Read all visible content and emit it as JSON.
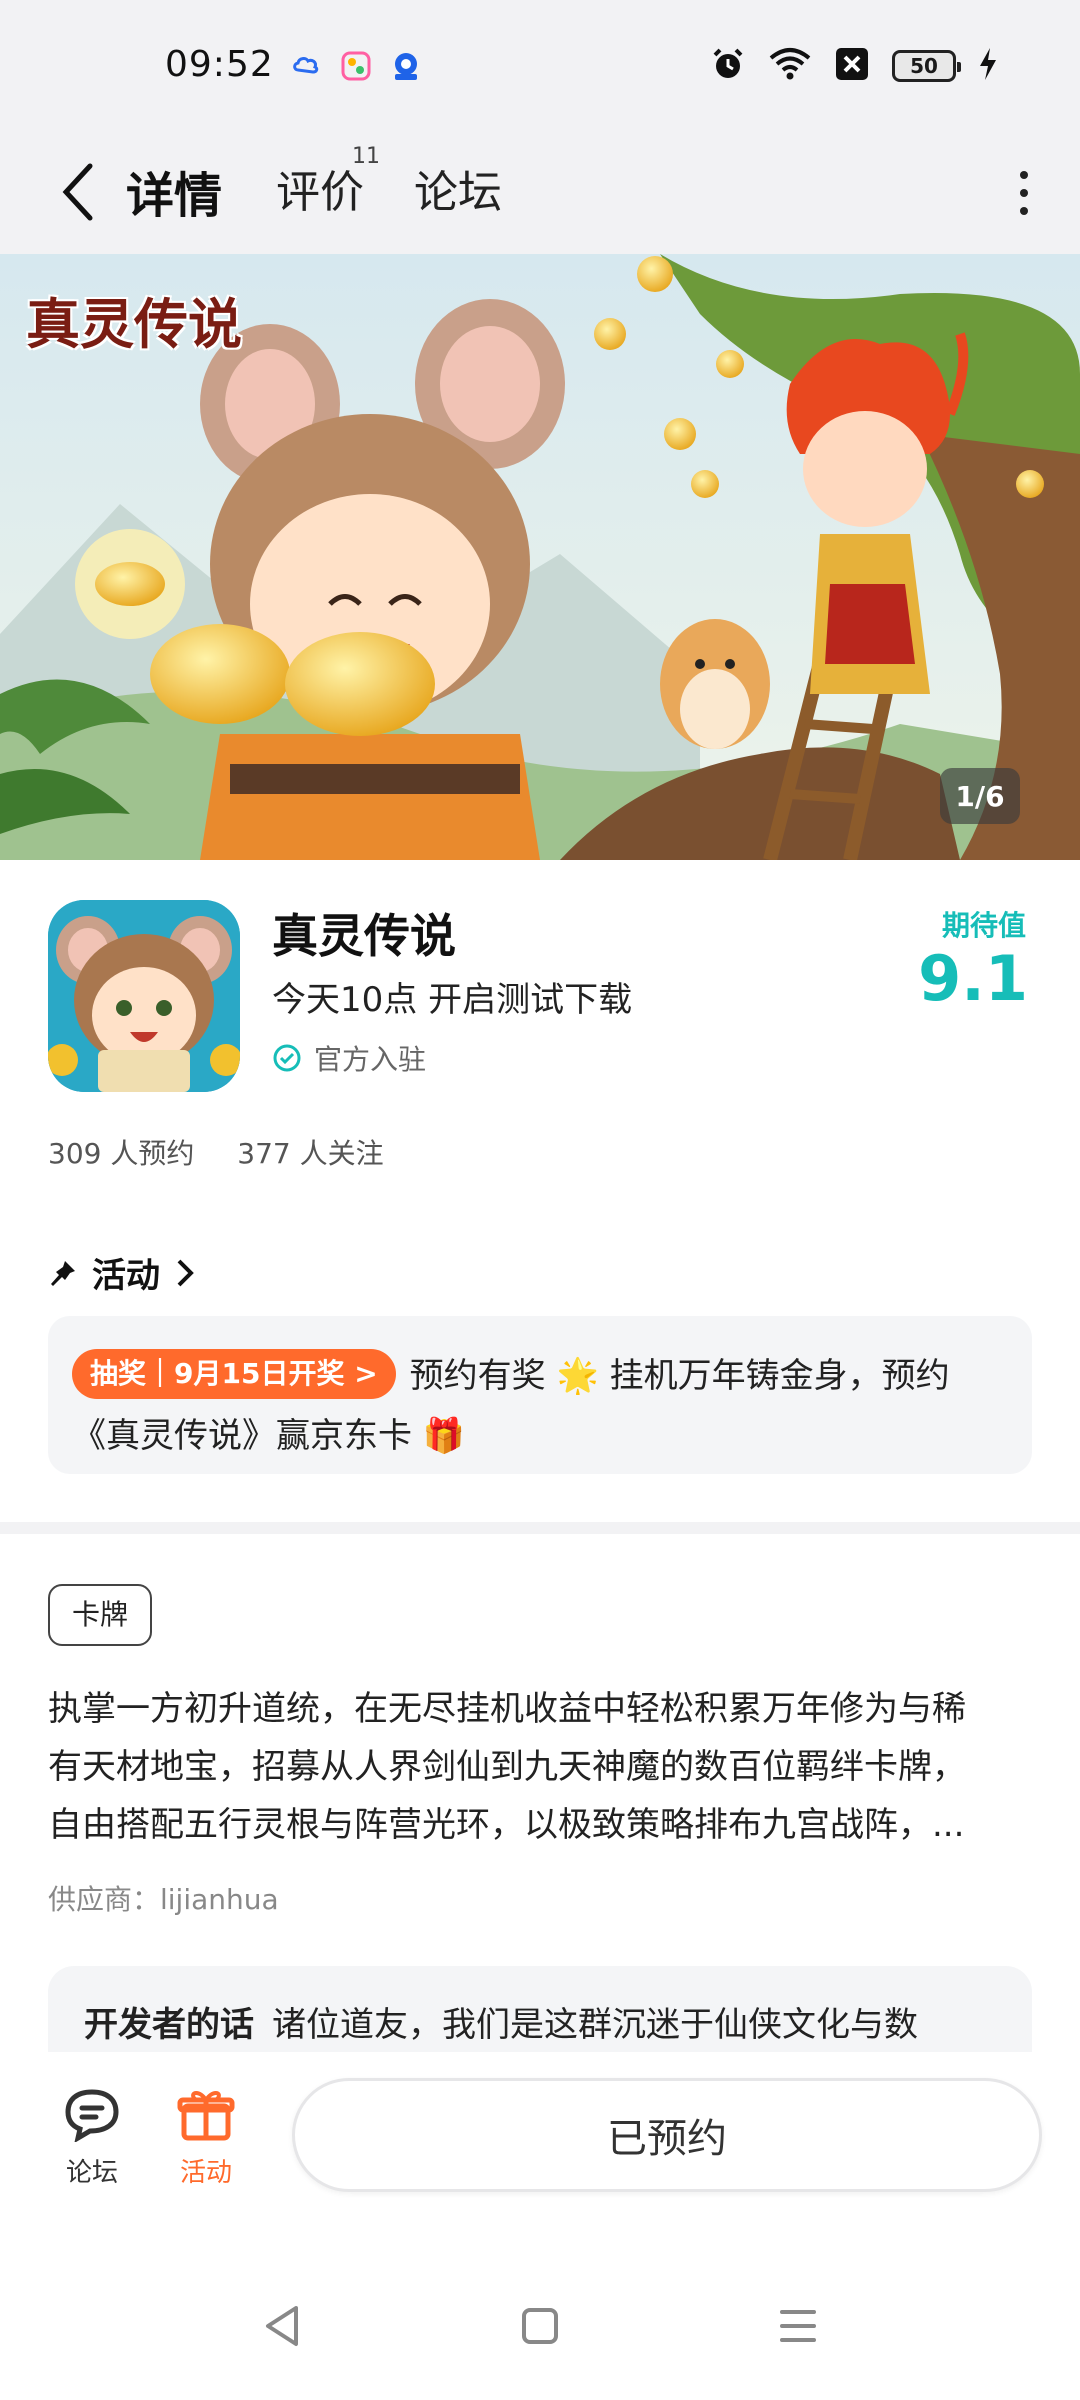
{
  "status_bar": {
    "time": "09:52",
    "app_icons": [
      "cloud-sync-icon",
      "photos-icon",
      "app-store-icon"
    ],
    "right_icons": [
      "alarm-icon",
      "wifi-icon",
      "signal-off-icon",
      "battery-icon",
      "charging-icon"
    ],
    "battery": "50"
  },
  "nav": {
    "tabs": [
      {
        "label": "详情",
        "active": true
      },
      {
        "label": "评价",
        "badge": "11"
      },
      {
        "label": "论坛"
      }
    ]
  },
  "banner": {
    "logo_text": "真灵传说",
    "counter": "1/6"
  },
  "app": {
    "name": "真灵传说",
    "subtitle": "今天10点 开启测试下载",
    "official": "官方入驻",
    "rating_label": "期待值",
    "rating_value": "9.1",
    "reservations": "309 人预约",
    "followers": "377 人关注"
  },
  "activity": {
    "title": "活动",
    "badge": "抽奖｜9月15日开奖 >",
    "text_part1": "预约有奖 🌟 挂机万年铸金身，预约",
    "text_part2": "《真灵传说》赢京东卡 🎁"
  },
  "description": {
    "tag": "卡牌",
    "lines": [
      "执掌一方初升道统，在无尽挂机收益中轻松积累万年修为与稀",
      "有天材地宝，招募从人界剑仙到九天神魔的数百位羁绊卡牌，",
      "自由搭配五行灵根与阵营光环，以极致策略排布九宫战阵，..."
    ],
    "supplier": "供应商：lijianhua"
  },
  "developer": {
    "title": "开发者的话",
    "text": "诸位道友，我们是这群沉迷于仙侠文化与数"
  },
  "bottom_bar": {
    "forum_label": "论坛",
    "activity_label": "活动",
    "reserve_label": "已预约"
  },
  "colors": {
    "accent": "#16bdb8",
    "orange": "#ff6a2c"
  }
}
